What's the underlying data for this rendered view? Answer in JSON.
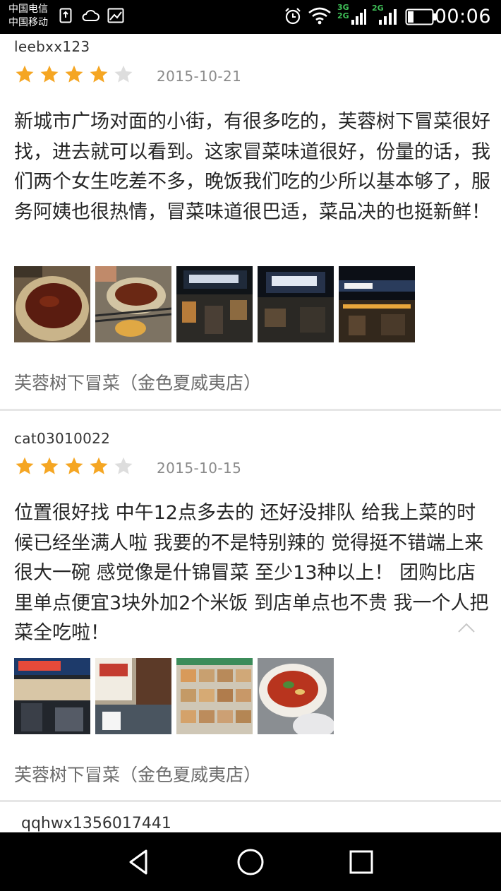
{
  "status_bar": {
    "carrier_1": "中国电信",
    "carrier_2": "中国移动",
    "net_3g": "3G",
    "net_2g_a": "2G",
    "net_2g_b": "2G",
    "time": "00:06",
    "icons": [
      "sim-icon",
      "cloud-icon",
      "image-icon",
      "alarm-icon",
      "wifi-icon",
      "signal-icon",
      "battery-icon"
    ]
  },
  "reviews": [
    {
      "username": "leebxx123",
      "rating": 4,
      "rating_max": 5,
      "date": "2015-10-21",
      "text": "新城市广场对面的小街，有很多吃的，芙蓉树下冒菜很好找，进去就可以看到。这家冒菜味道很好，份量的话，我们两个女生吃差不多，晚饭我们吃的少所以基本够了，服务阿姨也很热情，冒菜味道很巴适，菜品决的也挺新鲜！",
      "photo_count": 5,
      "shop": "芙蓉树下冒菜（金色夏威夷店）"
    },
    {
      "username": "cat03010022",
      "rating": 4,
      "rating_max": 5,
      "date": "2015-10-15",
      "text": "位置很好找  中午12点多去的  还好没排队  给我上菜的时候已经坐满人啦 我要的不是特别辣的 觉得挺不错端上来很大一碗 感觉像是什锦冒菜 至少13种以上！ 团购比店里单点便宜3块外加2个米饭  到店单点也不贵 我一个人把菜全吃啦！",
      "photo_count": 4,
      "shop": "芙蓉树下冒菜（金色夏威夷店）"
    },
    {
      "username": "qqhwx1356017441"
    }
  ],
  "colors": {
    "star_filled": "#F5A623",
    "star_empty": "#DDDDDD",
    "status_green": "#3FBF57"
  },
  "nav": {
    "buttons": [
      "back-icon",
      "home-icon",
      "recents-icon"
    ]
  }
}
